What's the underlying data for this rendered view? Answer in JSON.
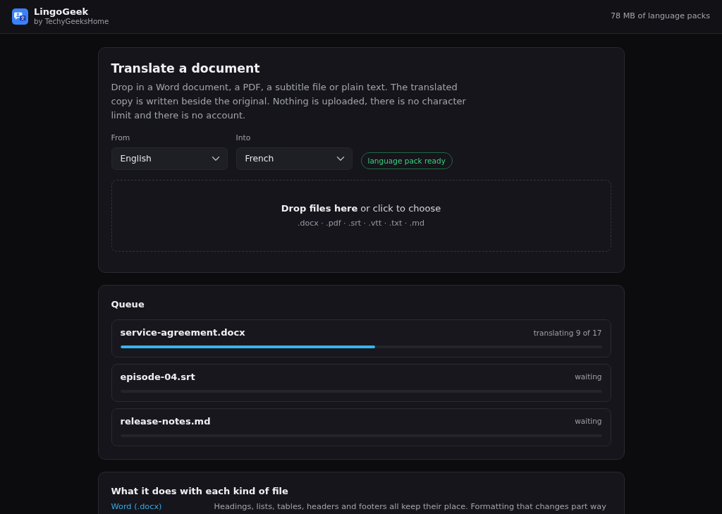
{
  "header": {
    "app_name": "LingoGeek",
    "publisher": "by TechyGeeksHome",
    "storage": "78 MB of language packs"
  },
  "translate": {
    "title": "Translate a document",
    "description": "Drop in a Word document, a PDF, a subtitle file or plain text. The translated copy is written beside the original. Nothing is uploaded, there is no character limit and there is no account.",
    "from": {
      "label": "From",
      "value": "English"
    },
    "into": {
      "label": "Into",
      "value": "French"
    },
    "status_badge": "language pack ready",
    "dropzone": {
      "prompt": "**Drop files here** or click to choose",
      "formats": ".docx · .pdf · .srt · .vtt · .txt · .md"
    }
  },
  "queue": {
    "title": "Queue",
    "items": [
      {
        "file": "service-agreement.docx",
        "status": "translating 9 of 17",
        "level": 0.53
      },
      {
        "file": "episode-04.srt",
        "status": "waiting"
      },
      {
        "file": "release-notes.md",
        "status": "waiting"
      }
    ]
  },
  "file_kinds": {
    "title": "What it does with each kind of file",
    "rows": [
      {
        "kind_label": "Word (.docx)",
        "description": "Headings, lists, tables, headers and footers all keep their place. Formatting that changes part way"
      }
    ]
  }
}
